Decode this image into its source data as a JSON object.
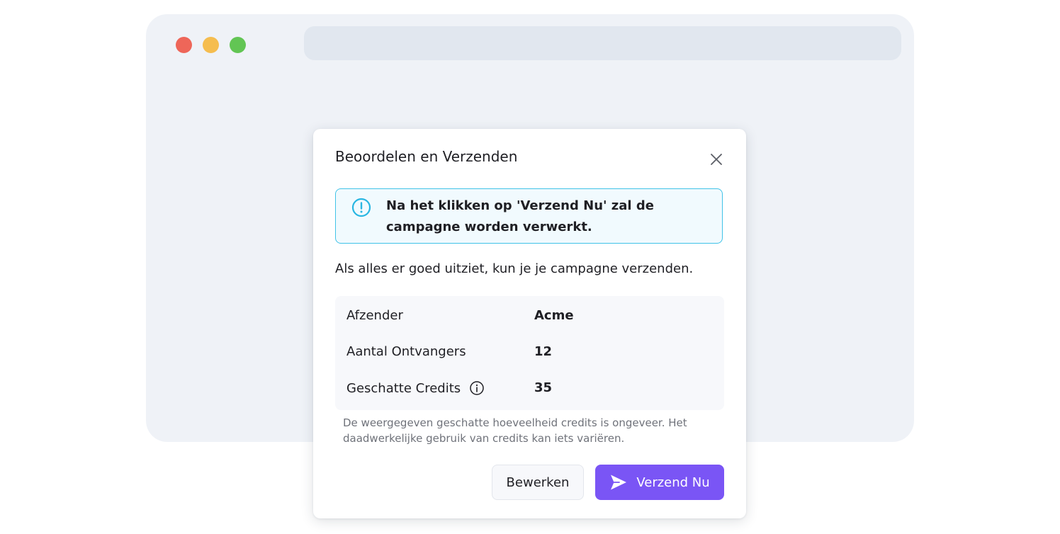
{
  "window": {
    "traffic_lights": [
      {
        "name": "close",
        "color": "#ee6659"
      },
      {
        "name": "minimize",
        "color": "#f5bd4f"
      },
      {
        "name": "maximize",
        "color": "#62c554"
      }
    ]
  },
  "modal": {
    "title": "Beoordelen en Verzenden",
    "close_icon": "close-icon",
    "alert": {
      "icon": "exclamation-circle-icon",
      "text": "Na het klikken op 'Verzend Nu' zal de campagne worden verwerkt.",
      "border_color": "#41c3e8"
    },
    "intro": "Als alles er goed uitziet, kun je je campagne verzenden.",
    "summary": {
      "rows": [
        {
          "label": "Afzender",
          "value": "Acme"
        },
        {
          "label": "Aantal Ontvangers",
          "value": "12"
        },
        {
          "label": "Geschatte Credits",
          "value": "35",
          "info_icon": "info-icon"
        }
      ]
    },
    "disclaimer": "De weergegeven geschatte hoeveelheid credits is ongeveer. Het daadwerkelijke gebruik van credits kan iets variëren.",
    "buttons": {
      "edit_label": "Bewerken",
      "send_label": "Verzend Nu",
      "send_icon": "send-icon",
      "primary_color": "#7a55f5"
    }
  }
}
